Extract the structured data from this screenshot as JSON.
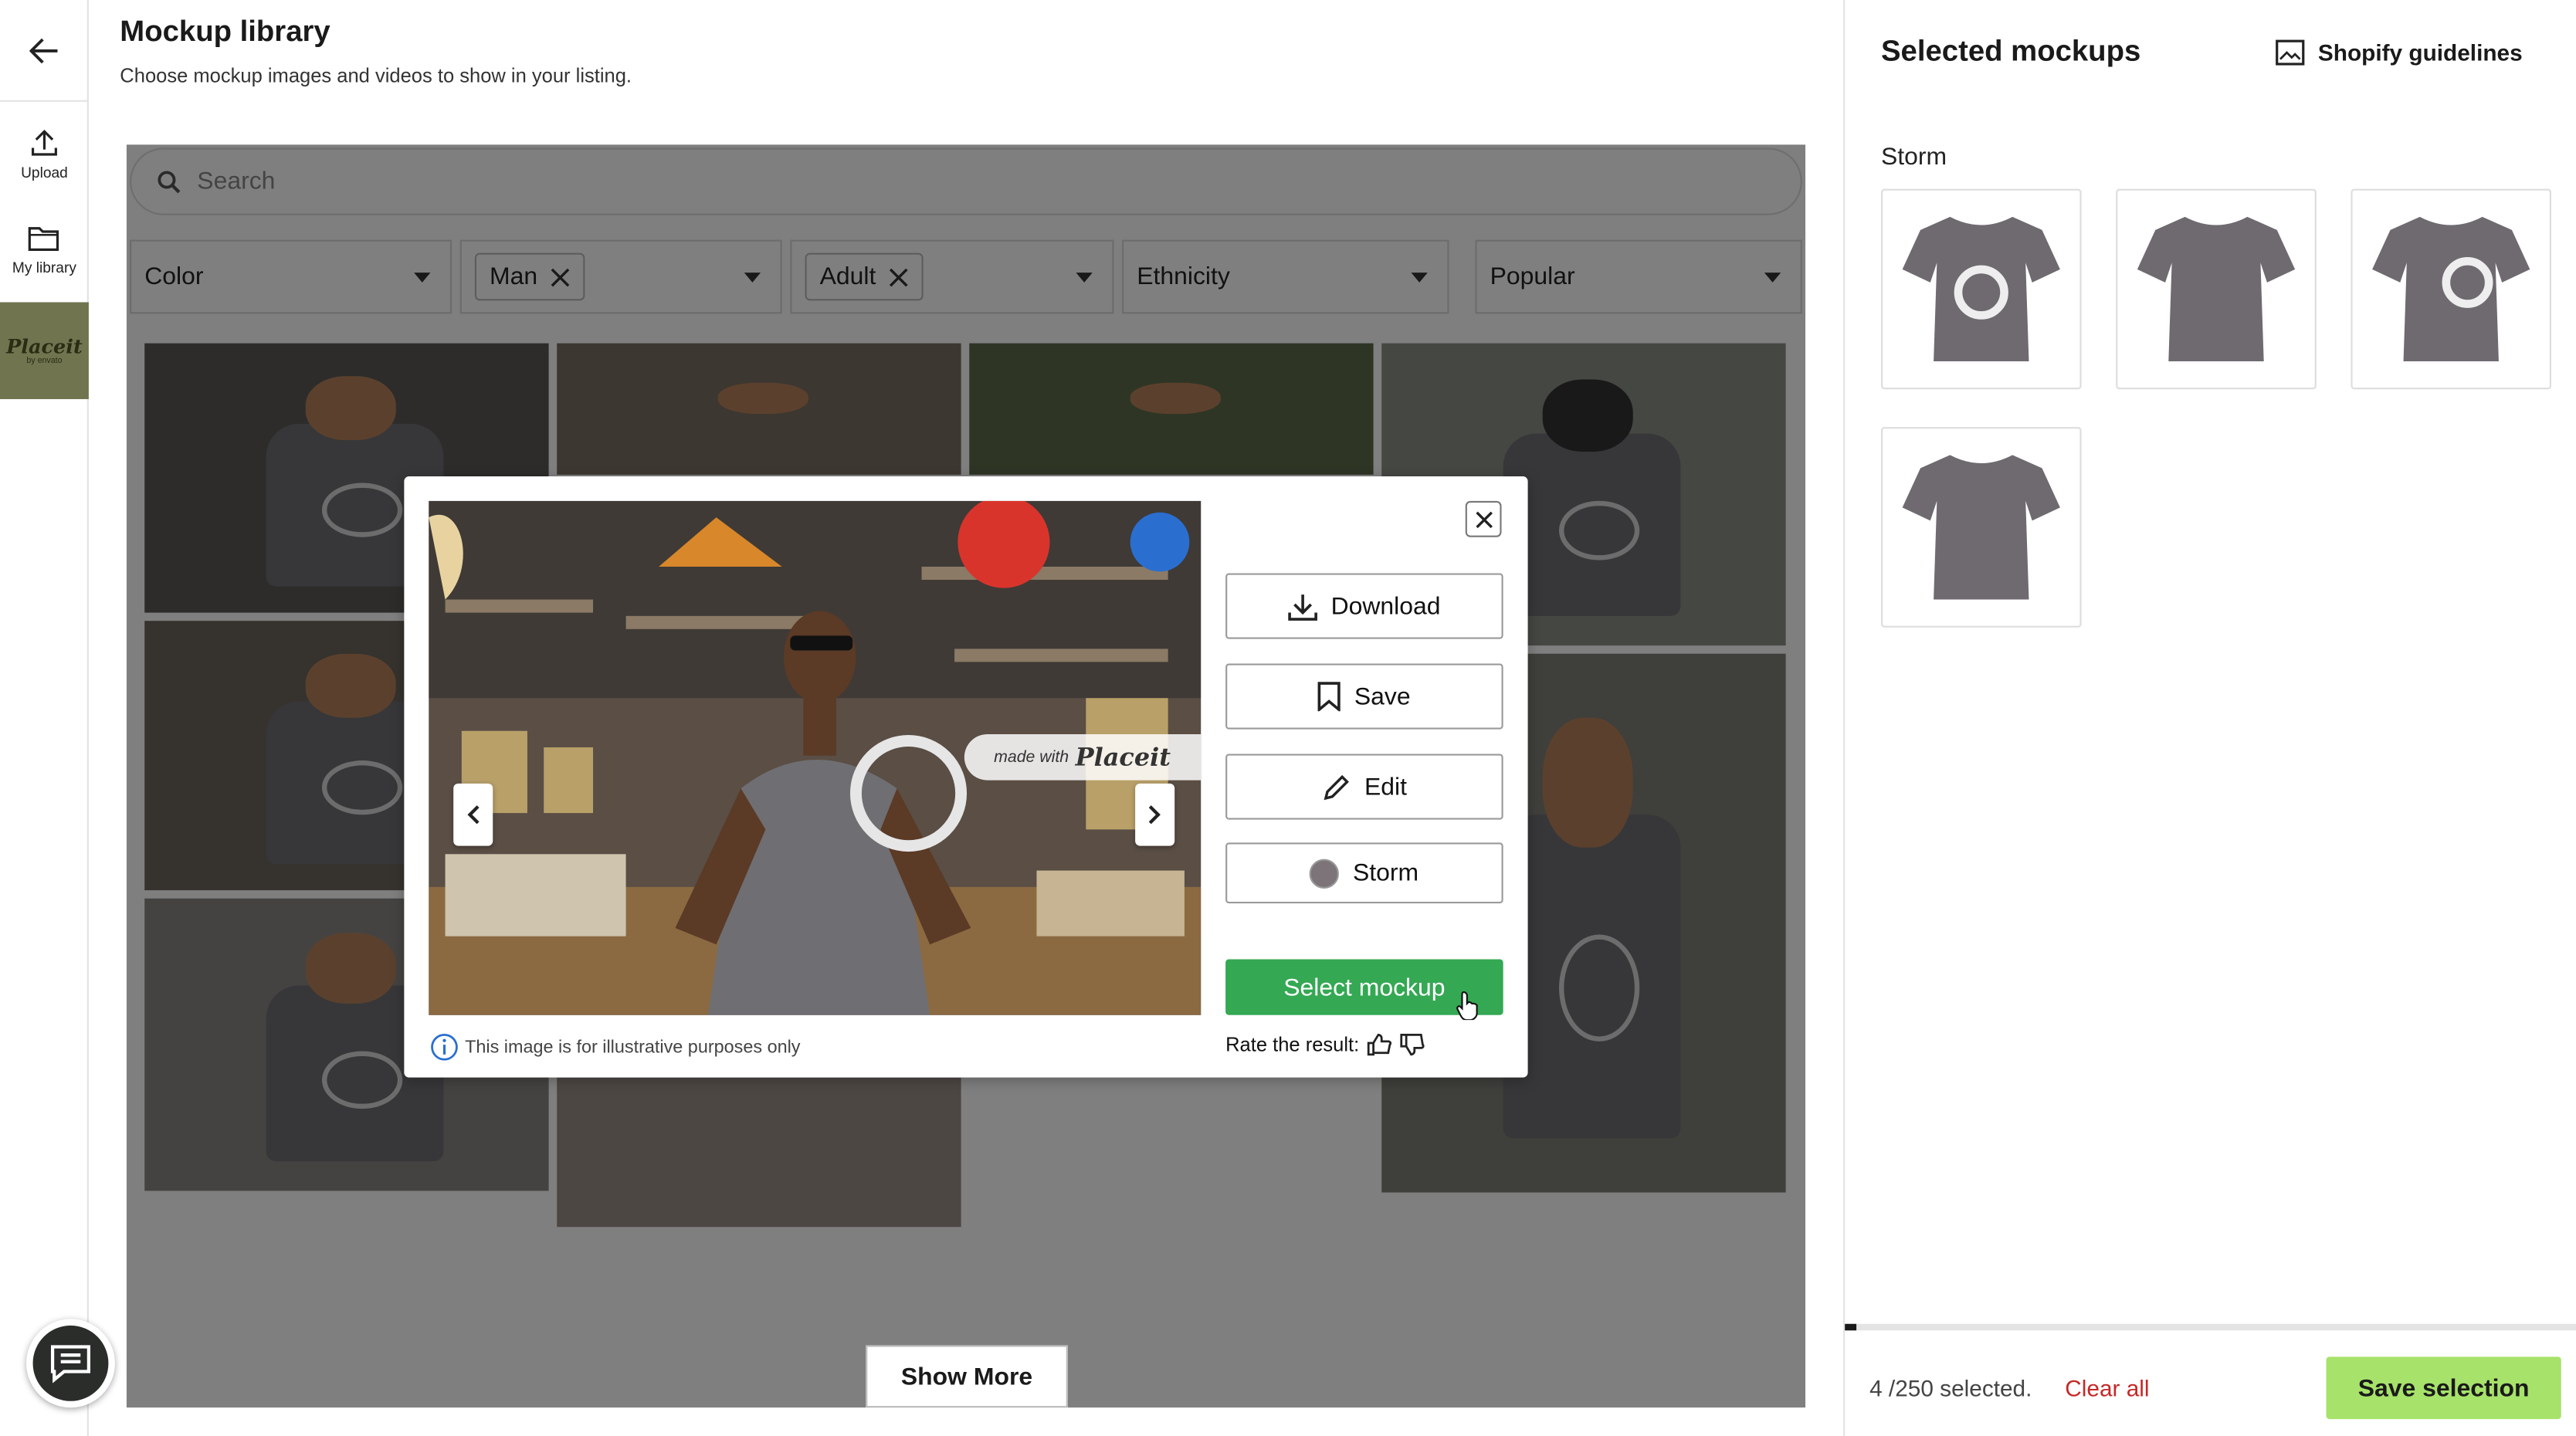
{
  "page": {
    "title": "Mockup library",
    "subtitle": "Choose mockup images and videos to show in your listing."
  },
  "rail": {
    "upload_label": "Upload",
    "library_label": "My library",
    "logo_text": "Placeit",
    "logo_sub": "by envato"
  },
  "search": {
    "placeholder": "Search"
  },
  "filters": {
    "color": "Color",
    "gender_chip": "Man",
    "age_chip": "Adult",
    "ethnicity": "Ethnicity",
    "sort": "Popular"
  },
  "library": {
    "show_more": "Show More"
  },
  "modal": {
    "watermark_prefix": "made with",
    "watermark_brand": "Placeit",
    "download": "Download",
    "save": "Save",
    "edit": "Edit",
    "color_option": "Storm",
    "color_swatch": "#7c7478",
    "select": "Select mockup",
    "note": "This image is for illustrative purposes only",
    "rate": "Rate the result:"
  },
  "side": {
    "title": "Selected mockups",
    "guidelines": "Shopify guidelines",
    "group": "Storm",
    "count": "4 /250 selected.",
    "clear_all": "Clear all",
    "save": "Save selection",
    "progress": 0.016
  },
  "colors": {
    "accent_green": "#34a853",
    "save_green": "#a7e26a",
    "danger": "#c62828",
    "shirt": "#6f6a70"
  }
}
